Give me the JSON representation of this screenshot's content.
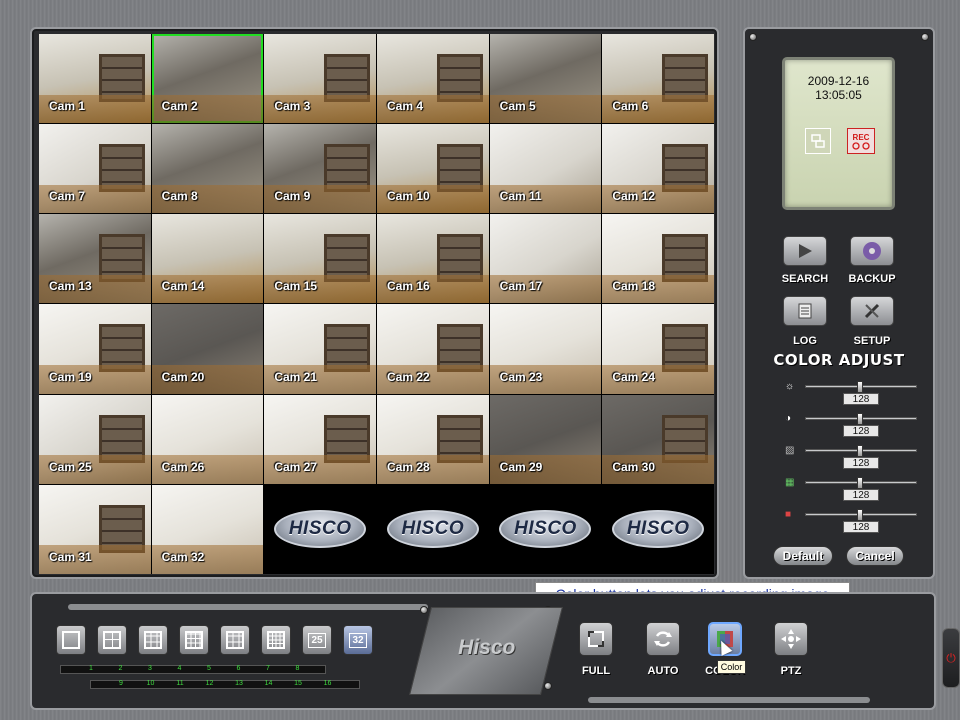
{
  "cameras": [
    {
      "label": "Cam 1"
    },
    {
      "label": "Cam 2"
    },
    {
      "label": "Cam 3"
    },
    {
      "label": "Cam 4"
    },
    {
      "label": "Cam 5"
    },
    {
      "label": "Cam 6"
    },
    {
      "label": "Cam 7"
    },
    {
      "label": "Cam 8"
    },
    {
      "label": "Cam 9"
    },
    {
      "label": "Cam 10"
    },
    {
      "label": "Cam 11"
    },
    {
      "label": "Cam 12"
    },
    {
      "label": "Cam 13"
    },
    {
      "label": "Cam 14"
    },
    {
      "label": "Cam 15"
    },
    {
      "label": "Cam 16"
    },
    {
      "label": "Cam 17"
    },
    {
      "label": "Cam 18"
    },
    {
      "label": "Cam 19"
    },
    {
      "label": "Cam 20"
    },
    {
      "label": "Cam 21"
    },
    {
      "label": "Cam 22"
    },
    {
      "label": "Cam 23"
    },
    {
      "label": "Cam 24"
    },
    {
      "label": "Cam 25"
    },
    {
      "label": "Cam 26"
    },
    {
      "label": "Cam 27"
    },
    {
      "label": "Cam 28"
    },
    {
      "label": "Cam 29"
    },
    {
      "label": "Cam 30"
    },
    {
      "label": "Cam 31"
    },
    {
      "label": "Cam 32"
    }
  ],
  "selected_camera": "Cam 2",
  "empty_slot_logo": "HISCO",
  "status": {
    "date": "2009-12-16",
    "time": "13:05:05",
    "rec_label": "REC"
  },
  "side_buttons": {
    "search": "SEARCH",
    "backup": "BACKUP",
    "log": "LOG",
    "setup": "SETUP"
  },
  "color_adjust": {
    "title": "COLOR ADJUST",
    "sliders": [
      {
        "icon": "brightness-icon",
        "value": "128",
        "level": 0.5
      },
      {
        "icon": "contrast-icon",
        "value": "128",
        "level": 0.5
      },
      {
        "icon": "saturation-icon",
        "value": "128",
        "level": 0.5
      },
      {
        "icon": "hue-icon",
        "value": "128",
        "level": 0.5
      },
      {
        "icon": "color-icon",
        "value": "128",
        "level": 0.5
      }
    ],
    "default_label": "Default",
    "cancel_label": "Cancel"
  },
  "layout_buttons": [
    "1",
    "4",
    "9",
    "16",
    "13",
    "25",
    "25",
    "32"
  ],
  "layout_active": "32",
  "layout_badges": {
    "25": "25",
    "32": "32"
  },
  "channel_row1": [
    "1",
    "2",
    "3",
    "4",
    "5",
    "6",
    "7",
    "8"
  ],
  "channel_row2": [
    "9",
    "10",
    "11",
    "12",
    "13",
    "14",
    "15",
    "16"
  ],
  "brand": "Hisco",
  "controls": {
    "full": "FULL",
    "auto": "AUTO",
    "color": "COLOR",
    "ptz": "PTZ"
  },
  "hint_text": "Color button lets you adjust recording image",
  "tooltip_text": "Color",
  "colors": {
    "selected_border": "#22dd22",
    "hint_text": "#1a33a0",
    "rec": "#d21818"
  }
}
